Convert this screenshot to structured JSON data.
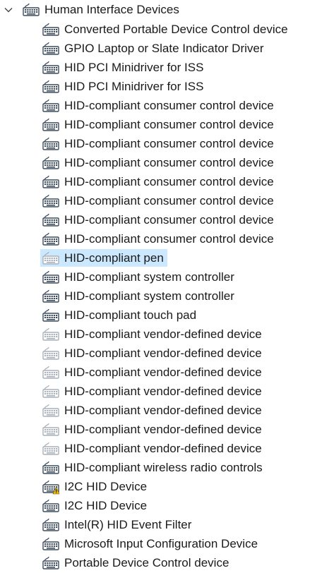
{
  "category": {
    "label": "Human Interface Devices",
    "expanded": true,
    "icon": "hid-device-icon"
  },
  "devices": [
    {
      "label": "Converted Portable Device Control device",
      "icon": "hid-device-icon",
      "state": "normal"
    },
    {
      "label": "GPIO Laptop or Slate Indicator Driver",
      "icon": "hid-device-icon",
      "state": "normal"
    },
    {
      "label": "HID PCI Minidriver for ISS",
      "icon": "hid-device-icon",
      "state": "normal"
    },
    {
      "label": "HID PCI Minidriver for ISS",
      "icon": "hid-device-icon",
      "state": "normal"
    },
    {
      "label": "HID-compliant consumer control device",
      "icon": "hid-device-icon",
      "state": "normal"
    },
    {
      "label": "HID-compliant consumer control device",
      "icon": "hid-device-icon",
      "state": "normal"
    },
    {
      "label": "HID-compliant consumer control device",
      "icon": "hid-device-icon",
      "state": "normal"
    },
    {
      "label": "HID-compliant consumer control device",
      "icon": "hid-device-icon",
      "state": "normal"
    },
    {
      "label": "HID-compliant consumer control device",
      "icon": "hid-device-icon",
      "state": "normal"
    },
    {
      "label": "HID-compliant consumer control device",
      "icon": "hid-device-icon",
      "state": "normal"
    },
    {
      "label": "HID-compliant consumer control device",
      "icon": "hid-device-icon",
      "state": "normal"
    },
    {
      "label": "HID-compliant consumer control device",
      "icon": "hid-device-icon",
      "state": "normal"
    },
    {
      "label": "HID-compliant pen",
      "icon": "hid-device-icon",
      "state": "hidden",
      "selected": true
    },
    {
      "label": "HID-compliant system controller",
      "icon": "hid-device-icon",
      "state": "normal"
    },
    {
      "label": "HID-compliant system controller",
      "icon": "hid-device-icon",
      "state": "normal"
    },
    {
      "label": "HID-compliant touch pad",
      "icon": "hid-device-icon",
      "state": "normal"
    },
    {
      "label": "HID-compliant vendor-defined device",
      "icon": "hid-device-icon",
      "state": "hidden"
    },
    {
      "label": "HID-compliant vendor-defined device",
      "icon": "hid-device-icon",
      "state": "hidden"
    },
    {
      "label": "HID-compliant vendor-defined device",
      "icon": "hid-device-icon",
      "state": "hidden"
    },
    {
      "label": "HID-compliant vendor-defined device",
      "icon": "hid-device-icon",
      "state": "hidden"
    },
    {
      "label": "HID-compliant vendor-defined device",
      "icon": "hid-device-icon",
      "state": "hidden"
    },
    {
      "label": "HID-compliant vendor-defined device",
      "icon": "hid-device-icon",
      "state": "hidden"
    },
    {
      "label": "HID-compliant vendor-defined device",
      "icon": "hid-device-icon",
      "state": "hidden"
    },
    {
      "label": "HID-compliant wireless radio controls",
      "icon": "hid-device-icon",
      "state": "normal"
    },
    {
      "label": "I2C HID Device",
      "icon": "hid-device-warning-icon",
      "state": "warning"
    },
    {
      "label": "I2C HID Device",
      "icon": "hid-device-icon",
      "state": "normal"
    },
    {
      "label": "Intel(R) HID Event Filter",
      "icon": "hid-device-icon",
      "state": "normal"
    },
    {
      "label": "Microsoft Input Configuration Device",
      "icon": "hid-device-icon",
      "state": "normal"
    },
    {
      "label": "Portable Device Control device",
      "icon": "hid-device-icon",
      "state": "normal"
    }
  ],
  "colors": {
    "selection": "#cce8ff",
    "icon_normal": "#3c4b5c",
    "icon_hidden": "#a9b1ba",
    "warning": "#f2c200",
    "text": "#1a1a1a"
  }
}
